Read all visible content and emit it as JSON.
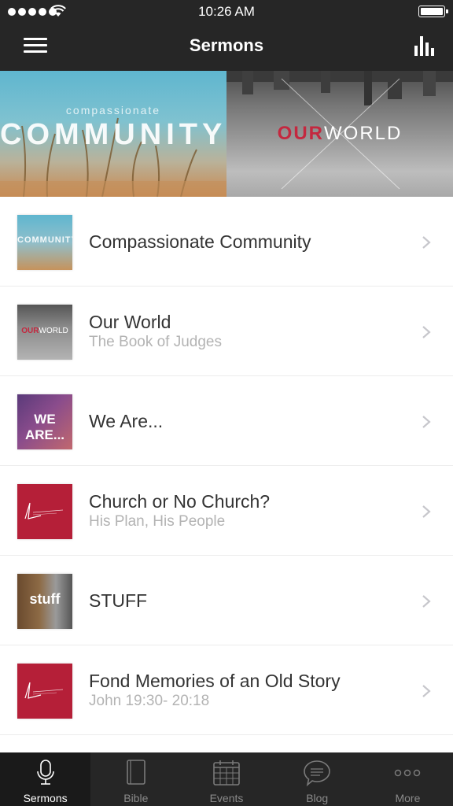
{
  "status_bar": {
    "time": "10:26 AM"
  },
  "nav": {
    "title": "Sermons"
  },
  "banner": {
    "left_small": "compassionate",
    "left_big": "COMMUNITY",
    "right_logo_part1": "OUR",
    "right_logo_part2": "WORLD"
  },
  "sermons": [
    {
      "title": "Compassionate Community",
      "subtitle": "",
      "thumb_text": "COMMUNITY"
    },
    {
      "title": "Our World",
      "subtitle": "The Book of Judges",
      "thumb_text_1": "OUR",
      "thumb_text_2": "WORLD"
    },
    {
      "title": "We Are...",
      "subtitle": "",
      "thumb_text": "WE ARE..."
    },
    {
      "title": "Church or No Church?",
      "subtitle": "His Plan, His People"
    },
    {
      "title": "STUFF",
      "subtitle": "",
      "thumb_text": "stuff"
    },
    {
      "title": "Fond Memories of an Old Story",
      "subtitle": "John 19:30- 20:18"
    }
  ],
  "tabs": [
    {
      "label": "Sermons",
      "icon": "microphone-icon",
      "active": true
    },
    {
      "label": "Bible",
      "icon": "book-icon",
      "active": false
    },
    {
      "label": "Events",
      "icon": "calendar-icon",
      "active": false
    },
    {
      "label": "Blog",
      "icon": "chat-bubble-icon",
      "active": false
    },
    {
      "label": "More",
      "icon": "more-dots-icon",
      "active": false
    }
  ],
  "colors": {
    "bar": "#262626",
    "brand_red": "#b51f38",
    "text": "#333333",
    "subtext": "#b3b3b3"
  }
}
